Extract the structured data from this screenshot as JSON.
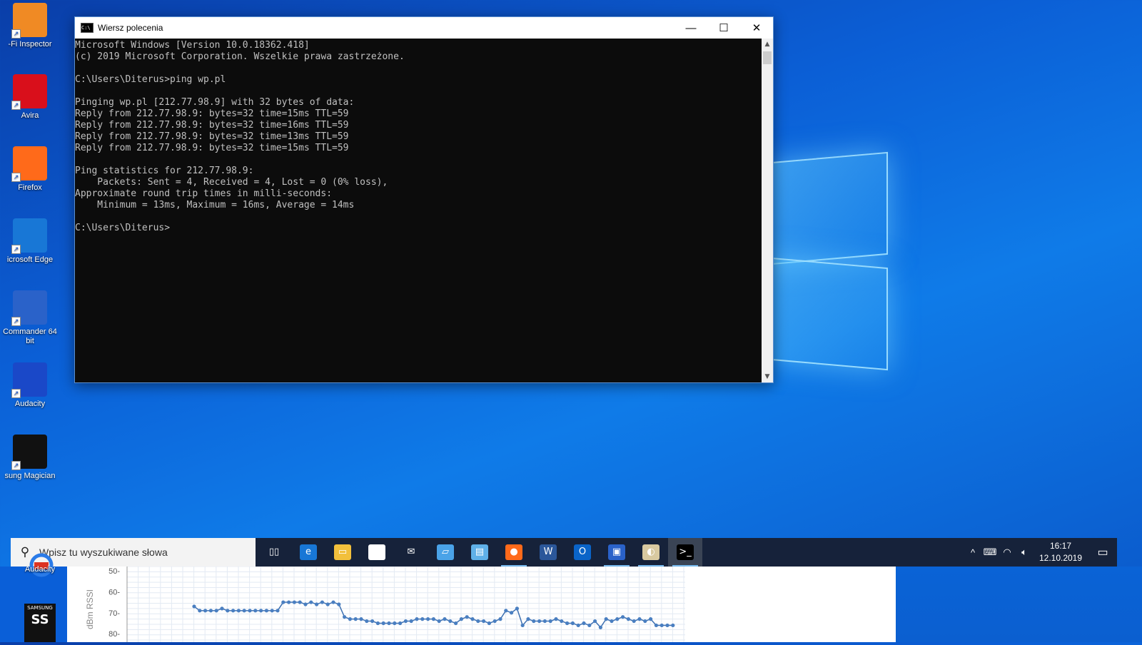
{
  "desktop": {
    "icons": [
      {
        "label": "-Fi Inspector",
        "icon": "wifi-inspector-icon",
        "color": "#f08a24"
      },
      {
        "label": "Avira",
        "icon": "avira-icon",
        "color": "#d90f1b"
      },
      {
        "label": "Firefox",
        "icon": "firefox-icon",
        "color": "#ff6a1a"
      },
      {
        "label": "icrosoft Edge",
        "icon": "edge-icon",
        "color": "#1877d6"
      },
      {
        "label": "Commander 64 bit",
        "icon": "total-commander-icon",
        "color": "#2a62c9"
      },
      {
        "label": "Audacity",
        "icon": "audacity-icon",
        "color": "#1a48c8"
      },
      {
        "label": "sung Magician",
        "icon": "samsung-magician-icon",
        "color": "#111111"
      }
    ],
    "lower_icons": [
      {
        "label": "Audacity",
        "icon": "audacity-icon"
      },
      {
        "label": "",
        "icon": "samsung-magician-icon"
      }
    ]
  },
  "cmd": {
    "title": "Wiersz polecenia",
    "lines": [
      "Microsoft Windows [Version 10.0.18362.418]",
      "(c) 2019 Microsoft Corporation. Wszelkie prawa zastrzeżone.",
      "",
      "C:\\Users\\Diterus>ping wp.pl",
      "",
      "Pinging wp.pl [212.77.98.9] with 32 bytes of data:",
      "Reply from 212.77.98.9: bytes=32 time=15ms TTL=59",
      "Reply from 212.77.98.9: bytes=32 time=16ms TTL=59",
      "Reply from 212.77.98.9: bytes=32 time=13ms TTL=59",
      "Reply from 212.77.98.9: bytes=32 time=15ms TTL=59",
      "",
      "Ping statistics for 212.77.98.9:",
      "    Packets: Sent = 4, Received = 4, Lost = 0 (0% loss),",
      "Approximate round trip times in milli-seconds:",
      "    Minimum = 13ms, Maximum = 16ms, Average = 14ms",
      "",
      "C:\\Users\\Diterus>"
    ]
  },
  "taskbar": {
    "search_placeholder": "Wpisz tu wyszukiwane słowa",
    "apps": [
      {
        "name": "task-view",
        "icon": "task-view-icon",
        "glyph": "▯▯",
        "color": "transparent",
        "running": false
      },
      {
        "name": "edge",
        "icon": "edge-icon",
        "glyph": "e",
        "color": "#1877d6",
        "running": false
      },
      {
        "name": "file-explorer",
        "icon": "folder-icon",
        "glyph": "▭",
        "color": "#f2c03c",
        "running": false
      },
      {
        "name": "store",
        "icon": "store-icon",
        "glyph": "▦",
        "color": "#ffffff",
        "running": false
      },
      {
        "name": "mail",
        "icon": "mail-icon",
        "glyph": "✉",
        "color": "transparent",
        "running": false
      },
      {
        "name": "this-pc",
        "icon": "laptop-icon",
        "glyph": "▱",
        "color": "#4aa3e8",
        "running": false
      },
      {
        "name": "control-panel",
        "icon": "control-panel-icon",
        "glyph": "▤",
        "color": "#5fb0e8",
        "running": false
      },
      {
        "name": "firefox",
        "icon": "firefox-icon",
        "glyph": "●",
        "color": "#ff6a1a",
        "running": true
      },
      {
        "name": "word",
        "icon": "word-icon",
        "glyph": "W",
        "color": "#2b579a",
        "running": false
      },
      {
        "name": "outlook",
        "icon": "outlook-icon",
        "glyph": "O",
        "color": "#0a64c8",
        "running": false
      },
      {
        "name": "total-commander",
        "icon": "floppy-icon",
        "glyph": "▣",
        "color": "#2a62c9",
        "running": true
      },
      {
        "name": "paint",
        "icon": "paint-icon",
        "glyph": "◐",
        "color": "#d8c9a0",
        "running": true
      },
      {
        "name": "command-prompt",
        "icon": "cmd-icon",
        "glyph": ">_",
        "color": "#000000",
        "running": true
      }
    ],
    "tray": {
      "chevron": "^",
      "clock_time": "16:17",
      "clock_date": "12.10.2019"
    }
  },
  "rssi_chart": {
    "ylabel": "dBm RSSI",
    "ticks": [
      "50-",
      "60-",
      "70-",
      "80-"
    ]
  },
  "chart_data": {
    "type": "line",
    "ylabel": "dBm RSSI",
    "ylim": [
      -84,
      -48
    ],
    "yticks": [
      -50,
      -60,
      -70,
      -80
    ],
    "grid": true,
    "series": [
      {
        "values": [
          -67,
          -69,
          -69,
          -69,
          -69,
          -68,
          -69,
          -69,
          -69,
          -69,
          -69,
          -69,
          -69,
          -69,
          -69,
          -69,
          -65,
          -65,
          -65,
          -65,
          -66,
          -65,
          -66,
          -65,
          -66,
          -65,
          -66,
          -72,
          -73,
          -73,
          -73,
          -74,
          -74,
          -75,
          -75,
          -75,
          -75,
          -75,
          -74,
          -74,
          -73,
          -73,
          -73,
          -73,
          -74,
          -73,
          -74,
          -75,
          -73,
          -72,
          -73,
          -74,
          -74,
          -75,
          -74,
          -73,
          -69,
          -70,
          -68,
          -76,
          -73,
          -74,
          -74,
          -74,
          -74,
          -73,
          -74,
          -75,
          -75,
          -76,
          -75,
          -76,
          -74,
          -77,
          -73,
          -74,
          -73,
          -72,
          -73,
          -74,
          -73,
          -74,
          -73,
          -76,
          -76,
          -76,
          -76
        ]
      }
    ]
  }
}
